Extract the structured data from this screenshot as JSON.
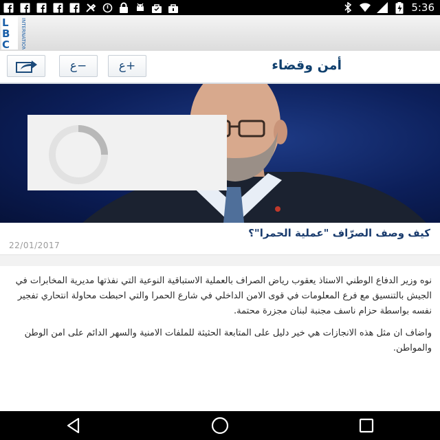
{
  "status_bar": {
    "time": "5:36",
    "left_icons": [
      "facebook-icon",
      "facebook-icon",
      "facebook-icon",
      "facebook-icon",
      "facebook-icon",
      "tools-icon",
      "do-not-disturb-icon",
      "lock-icon",
      "android-icon",
      "bag-icon",
      "bag-icon"
    ],
    "right_icons": [
      "bluetooth-icon",
      "wifi-icon",
      "signal-icon",
      "battery-charging-icon"
    ]
  },
  "app": {
    "logo_text": "LBC",
    "logo_subtext": "INTERNATIONAL",
    "brand_color": "#1a5fa8"
  },
  "toolbar": {
    "section_title": "أمن وقضاء",
    "font_decrease_label": "ع−",
    "font_increase_label": "ع+",
    "share_icon": "share-icon"
  },
  "article": {
    "title": "كيف وصف الصرّاف \"عملية الحمرا\"؟",
    "date": "22/01/2017",
    "paragraphs": [
      "نوه وزير الدفاع الوطني الاستاذ يعقوب رياض الصراف بالعملية الاستباقية النوعية التي نفذتها مديرية المخابرات في الجيش بالتنسيق مع فرع المعلومات في قوى الامن الداخلي في شارع الحمرا والتي احبطت محاولة انتحاري تفجير نفسه بواسطة حزام ناسف مجنبة لبنان مجزرة محتمة.",
      "واضاف ان مثل هذه الانجازات هي خير دليل على المتابعة الحثيثة للملفات الامنية والسهر الدائم على امن الوطن والمواطن."
    ],
    "image_loading": true
  },
  "nav_bar": {
    "buttons": [
      "back-icon",
      "home-icon",
      "recents-icon"
    ]
  }
}
